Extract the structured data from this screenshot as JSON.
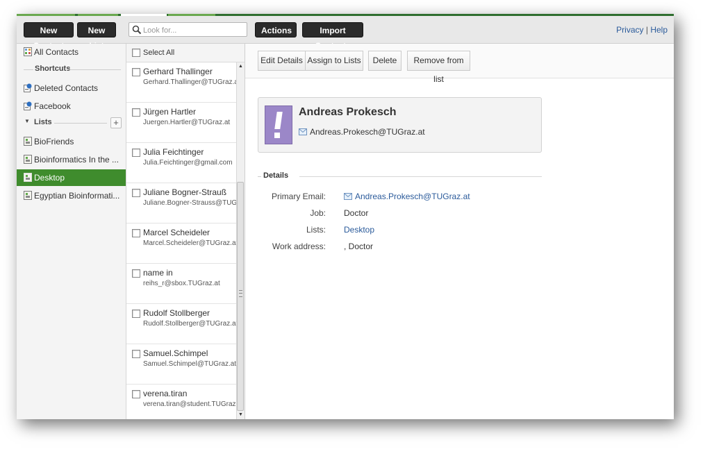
{
  "toolbar": {
    "new_contact": "New Contact",
    "new_list": "New List",
    "search_placeholder": "Look for...",
    "actions": "Actions",
    "import_contacts": "Import Contacts",
    "privacy": "Privacy",
    "separator": "|",
    "help": "Help"
  },
  "sidebar": {
    "all_contacts": "All Contacts",
    "shortcuts_header": "Shortcuts",
    "shortcuts": [
      "Deleted Contacts",
      "Facebook"
    ],
    "lists_header": "Lists",
    "add_list": "+",
    "lists": [
      "BioFriends",
      "Bioinformatics In the ...",
      "Desktop",
      "Egyptian Bioinformati..."
    ],
    "active_list": "Desktop"
  },
  "contact_list": {
    "select_all": "Select All",
    "contacts": [
      {
        "name": "Gerhard Thallinger",
        "email": "Gerhard.Thallinger@TUGraz.at"
      },
      {
        "name": "Jürgen Hartler",
        "email": "Juergen.Hartler@TUGraz.at"
      },
      {
        "name": "Julia Feichtinger",
        "email": "Julia.Feichtinger@gmail.com"
      },
      {
        "name": "Juliane Bogner-Strauß",
        "email": "Juliane.Bogner-Strauss@TUGraz.at"
      },
      {
        "name": "Marcel Scheideler",
        "email": "Marcel.Scheideler@TUGraz.at"
      },
      {
        "name": "name in",
        "email": "reihs_r@sbox.TUGraz.at"
      },
      {
        "name": "Rudolf Stollberger",
        "email": "Rudolf.Stollberger@TUGraz.at"
      },
      {
        "name": "Samuel.Schimpel",
        "email": "Samuel.Schimpel@TUGraz.at"
      },
      {
        "name": "verena.tiran",
        "email": "verena.tiran@student.TUGraz.at"
      }
    ]
  },
  "detail": {
    "buttons": {
      "edit_details": "Edit Details",
      "assign_to_lists": "Assign to Lists",
      "delete": "Delete",
      "remove_from_list": "Remove from list"
    },
    "card": {
      "name": "Andreas Prokesch",
      "email": "Andreas.Prokesch@TUGraz.at"
    },
    "details_header": "Details",
    "fields": {
      "primary_email_label": "Primary Email:",
      "primary_email": "Andreas.Prokesch@TUGraz.at",
      "job_label": "Job:",
      "job": "Doctor",
      "lists_label": "Lists:",
      "lists": "Desktop",
      "work_address_label": "Work address:",
      "work_address": ", Doctor"
    }
  },
  "colors": {
    "accent_green": "#3f8c2d",
    "stripe_green": "#2f6e2f",
    "link_blue": "#2a5a9a",
    "avatar_purple": "#9b87c8",
    "button_dark": "#2b2b2b"
  }
}
